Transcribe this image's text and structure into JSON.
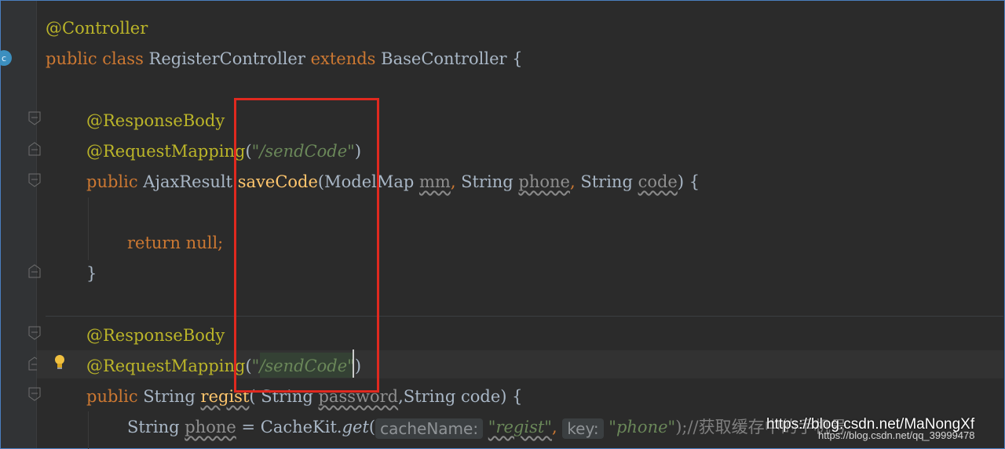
{
  "editor": {
    "lines": {
      "l1": {
        "annotation": "@Controller"
      },
      "l2": {
        "kw_public": "public",
        "kw_class": "class",
        "class_name": "RegisterController",
        "kw_extends": "extends",
        "base": "BaseController",
        "brace": "{"
      },
      "l4": {
        "annotation": "@ResponseBody"
      },
      "l5": {
        "annotation": "@RequestMapping",
        "open": "(",
        "string": "\"/sendCode\"",
        "close": ")"
      },
      "l6": {
        "kw_public": "public",
        "ret_type": "AjaxResult",
        "method": "saveCode",
        "params_start": "(ModelMap ",
        "p1": "mm",
        "sep1": ", ",
        "type2": "String ",
        "p2": "phone",
        "sep2": ", ",
        "type3": "String ",
        "p3": "code",
        "end": ") {"
      },
      "l8": {
        "kw_return": "return",
        "kw_null": "null",
        "semi": ";"
      },
      "l9": {
        "brace": "}"
      },
      "l11": {
        "annotation": "@ResponseBody"
      },
      "l12": {
        "annotation": "@RequestMapping",
        "open": "(",
        "string_a": "\"/sendCode",
        "string_b": "\"",
        "close": ")"
      },
      "l13": {
        "kw_public": "public",
        "ret_type": "String",
        "method": "regist",
        "params_a": "( String ",
        "p1": "password",
        "params_b": ",String code) {"
      },
      "l14": {
        "type": "String ",
        "var": "phone",
        "assign": " = CacheKit.",
        "method": "get",
        "open": "(",
        "hint1": "cacheName:",
        "arg1": "\"regist\"",
        "comma": ", ",
        "hint2": "key:",
        "arg2": "\"phone\"",
        "rest": ");//获取缓存中的手机号"
      }
    }
  },
  "watermark": {
    "line1": "https://blog.csdn.net/MaNongXf",
    "line2": "https://blog.csdn.net/qq_39999478"
  },
  "colors": {
    "background": "#2b2b2b",
    "keyword": "#cc7832",
    "annotation": "#bbb529",
    "string": "#6a8759",
    "method": "#ffc66d",
    "highlight_box": "#e0291f"
  }
}
